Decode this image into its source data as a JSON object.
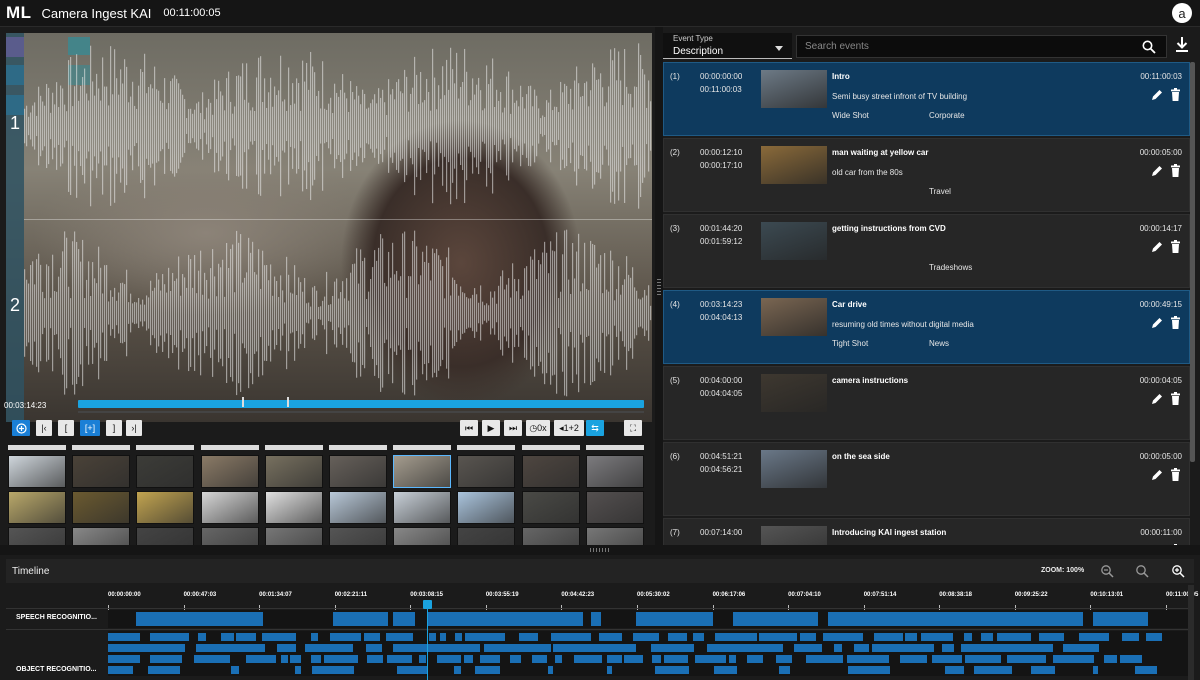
{
  "app": {
    "logo": "ML",
    "title": "Camera Ingest KAI",
    "timecode": "00:11:00:05",
    "user_initial": "a"
  },
  "player": {
    "channel_1": "1",
    "channel_2": "2",
    "current_time": "00:03:14:23",
    "speed_label": "0x",
    "audio_label": "1+2",
    "scrub_markers": [
      0.29,
      0.37
    ]
  },
  "thumb_rows": [
    [
      "#cfd6dc",
      "#4a4238",
      "#3c3c38",
      "#8a7a66",
      "#77705f",
      "#66605a",
      "#a49c8e",
      "#595550",
      "#4e4640",
      "#7c7b7e"
    ],
    [
      "#b9a86a",
      "#6b5a30",
      "#c2a450",
      "#d6d6d6",
      "#e0e0e0",
      "#b8c8d8",
      "#c8d0d8",
      "#aac4dd",
      "#4a4a46",
      "#545050"
    ],
    [
      "#555",
      "#888",
      "#444",
      "#666",
      "#777",
      "#555",
      "#888",
      "#444",
      "#666",
      "#777"
    ]
  ],
  "filter": {
    "type_label": "Event Type",
    "type_value": "Description",
    "search_placeholder": "Search events"
  },
  "events": [
    {
      "idx": "(1)",
      "in": "00:00:00:00",
      "out": "00:11:00:03",
      "title": "Intro",
      "desc": "Semi busy street infront of TV building",
      "tag1": "Wide Shot",
      "tag2": "Corporate",
      "dur": "00:11:00:03",
      "thumb": "#6d7a86",
      "selected": true
    },
    {
      "idx": "(2)",
      "in": "00:00:12:10",
      "out": "00:00:17:10",
      "title": "man waiting at yellow car",
      "desc": "old car from the 80s",
      "tag1": "",
      "tag2": "Travel",
      "dur": "00:00:05:00",
      "thumb": "#8a6a3a",
      "selected": false
    },
    {
      "idx": "(3)",
      "in": "00:01:44:20",
      "out": "00:01:59:12",
      "title": "getting instructions from CVD",
      "desc": "",
      "tag1": "",
      "tag2": "Tradeshows",
      "dur": "00:00:14:17",
      "thumb": "#3c4a52",
      "selected": false
    },
    {
      "idx": "(4)",
      "in": "00:03:14:23",
      "out": "00:04:04:13",
      "title": "Car drive",
      "desc": "resuming old times without digital media",
      "tag1": "Tight Shot",
      "tag2": "News",
      "dur": "00:00:49:15",
      "thumb": "#7a6652",
      "selected": true
    },
    {
      "idx": "(5)",
      "in": "00:04:00:00",
      "out": "00:04:04:05",
      "title": "camera instructions",
      "desc": "",
      "tag1": "",
      "tag2": "",
      "dur": "00:00:04:05",
      "thumb": "#3e3830",
      "selected": false
    },
    {
      "idx": "(6)",
      "in": "00:04:51:21",
      "out": "00:04:56:21",
      "title": "on the sea side",
      "desc": "",
      "tag1": "",
      "tag2": "",
      "dur": "00:00:05:00",
      "thumb": "#6a7888",
      "selected": false
    },
    {
      "idx": "(7)",
      "in": "00:07:14:00",
      "out": "",
      "title": "Introducing KAI ingest station",
      "desc": "",
      "tag1": "",
      "tag2": "",
      "dur": "00:00:11:00",
      "thumb": "#555",
      "selected": false
    }
  ],
  "timeline": {
    "title": "Timeline",
    "zoom": "ZOOM: 100%",
    "ticks": [
      "00:00:00:00",
      "00:00:47:03",
      "00:01:34:07",
      "00:02:21:11",
      "00:03:08:15",
      "00:03:55:19",
      "00:04:42:23",
      "00:05:30:02",
      "00:06:17:06",
      "00:07:04:10",
      "00:07:51:14",
      "00:08:38:18",
      "00:09:25:22",
      "00:10:13:01",
      "00:11:00:05"
    ],
    "tracks": [
      "SPEECH RECOGNITIO...",
      "OBJECT RECOGNITIO..."
    ],
    "playhead_time": "00:03:14:23"
  },
  "colors": {
    "accent": "#1aa3e0",
    "selected_event": "#0e3a5e",
    "track_bar": "#1a6fb5"
  }
}
